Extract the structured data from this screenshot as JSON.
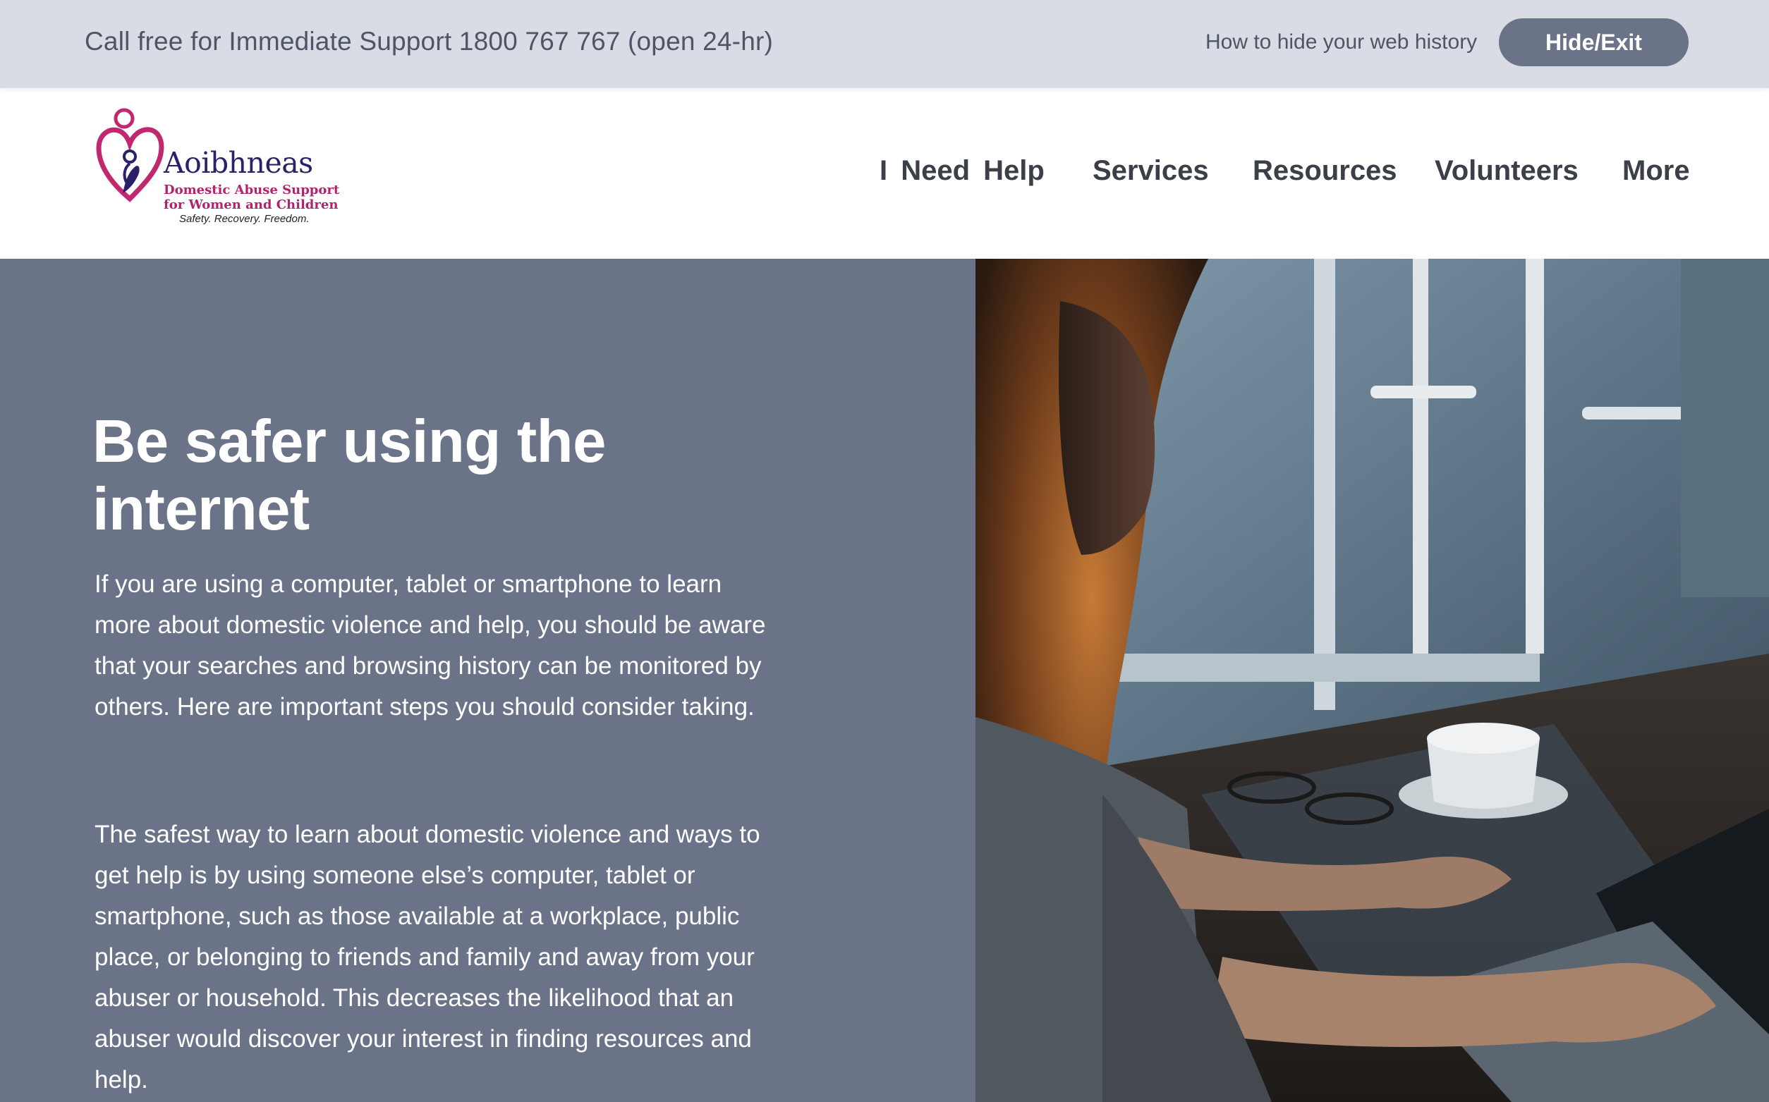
{
  "topbar": {
    "support_text": "Call free for Immediate Support 1800 767 767 (open 24-hr)",
    "history_link": "How to hide your web history",
    "hide_button": "Hide/Exit"
  },
  "logo": {
    "name": "Aoibhneas",
    "subtitle_line1": "Domestic Abuse Support",
    "subtitle_line2": "for Women and Children",
    "tagline": "Safety. Recovery. Freedom."
  },
  "nav": {
    "items": [
      "I Need Help",
      "Services",
      "Resources",
      "Volunteers",
      "More"
    ]
  },
  "hero": {
    "title": "Be safer using the internet",
    "paragraph1": "If you are using a computer, tablet or smartphone to learn more about domestic violence and help, you should be aware that your searches and browsing history can be monitored by others. Here are important steps you should consider taking.",
    "paragraph2": "The safest way to learn about domestic violence and ways to get help is by using someone else’s computer, tablet or smartphone, such as those available at a workplace, public place, or belonging to friends and family and away from your abuser or household. This decreases the likelihood that an abuser would discover your interest in finding resources and help."
  },
  "colors": {
    "topbar_bg": "#d9dce4",
    "accent_slate": "#6b7388",
    "logo_navy": "#2a2166",
    "logo_magenta": "#b0246e"
  }
}
